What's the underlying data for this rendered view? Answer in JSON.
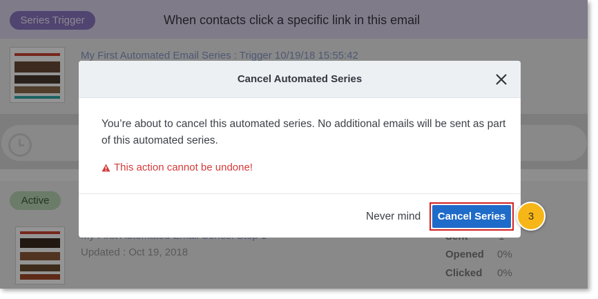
{
  "background": {
    "series_trigger_label": "Series Trigger",
    "trigger_heading": "When contacts click a specific link in this email",
    "trigger_email_link": "My First Automated Email Series : Trigger 10/19/18 15:55:42",
    "active_label": "Active",
    "step_email_link": "My First Automated Email Series: Step 1",
    "updated_text": "Updated : Oct 19, 2018",
    "stats": [
      {
        "label": "Sent",
        "value": "1"
      },
      {
        "label": "Opened",
        "value": "0%"
      },
      {
        "label": "Clicked",
        "value": "0%"
      }
    ]
  },
  "modal": {
    "title": "Cancel Automated Series",
    "close_icon": "close-icon",
    "message": "You’re about to cancel this automated series. No additional emails will be sent as part of this automated series.",
    "warning_icon": "warning-triangle-icon",
    "warning_text": "This action cannot be undone!",
    "never_mind_label": "Never mind",
    "cancel_series_label": "Cancel Series"
  },
  "callout": {
    "step_number": "3"
  },
  "colors": {
    "primary_button": "#1f6bc9",
    "highlight_border": "#d32020",
    "warning_text": "#d43a3a",
    "callout_badge": "#f7b617"
  }
}
